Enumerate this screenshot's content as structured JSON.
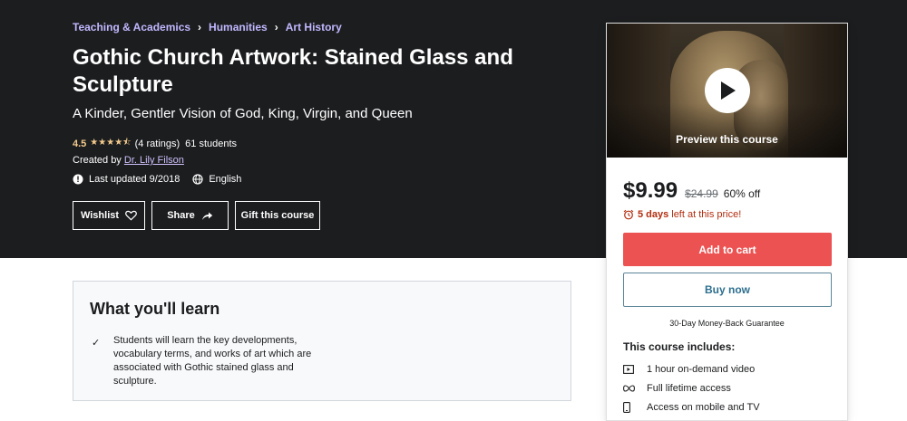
{
  "breadcrumb": [
    "Teaching & Academics",
    "Humanities",
    "Art History"
  ],
  "course": {
    "title": "Gothic Church Artwork: Stained Glass and Sculpture",
    "subtitle": "A Kinder, Gentler Vision of God, King, Virgin, and Queen",
    "rating": "4.5",
    "stars_value": 4.5,
    "rating_count": "(4 ratings)",
    "students": "61 students",
    "created_by_label": "Created by",
    "instructor": "Dr. Lily Filson",
    "last_updated": "Last updated 9/2018",
    "language": "English"
  },
  "actions": {
    "wishlist": "Wishlist",
    "share": "Share",
    "gift": "Gift this course"
  },
  "learn": {
    "heading": "What you'll learn",
    "items": [
      "Students will learn the key developments, vocabulary terms, and works of art which are associated with Gothic stained glass and sculpture."
    ]
  },
  "sidebar": {
    "preview_label": "Preview this course",
    "price": "$9.99",
    "original_price": "$24.99",
    "discount": "60% off",
    "timer_bold": "5 days",
    "timer_rest": "left at this price!",
    "add_to_cart": "Add to cart",
    "buy_now": "Buy now",
    "guarantee": "30-Day Money-Back Guarantee",
    "includes_title": "This course includes:",
    "includes": [
      {
        "icon": "video-icon",
        "label": "1 hour on-demand video"
      },
      {
        "icon": "infinity-icon",
        "label": "Full lifetime access"
      },
      {
        "icon": "mobile-icon",
        "label": "Access on mobile and TV"
      }
    ]
  },
  "colors": {
    "hero_bg": "#1c1d1f",
    "accent_link": "#cec0fc",
    "star": "#f3ca8c",
    "cart_button": "#ec5252",
    "timer_red": "#b32d0f"
  }
}
